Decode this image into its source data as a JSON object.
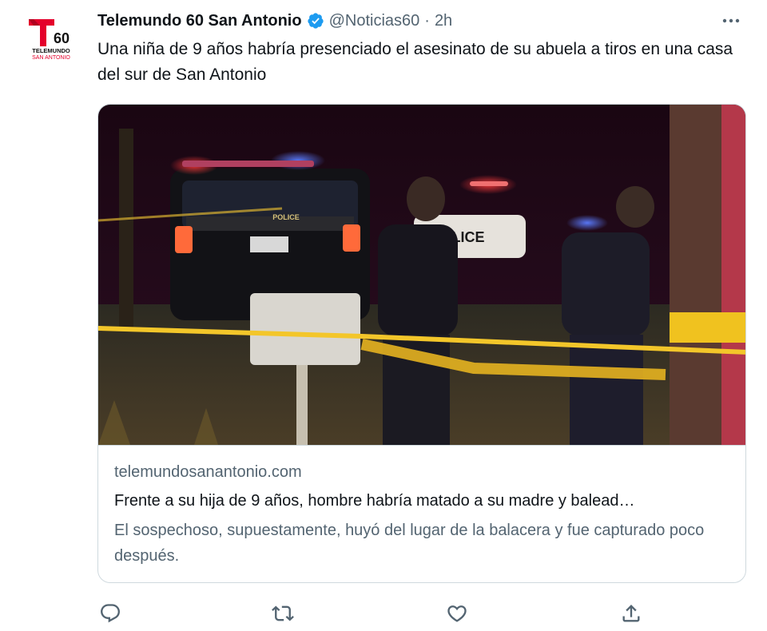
{
  "author": {
    "display_name": "Telemundo 60 San Antonio",
    "handle": "@Noticias60",
    "separator": "·",
    "time": "2h",
    "verified": true,
    "logo": {
      "number": "60",
      "line1": "TELEMUNDO",
      "line2": "SAN ANTONIO",
      "brand_color": "#e4002b"
    }
  },
  "tweet": {
    "text": "Una niña de 9 años habría presenciado el asesinato de su abuela a tiros en una casa del sur de San Antonio"
  },
  "card": {
    "image_alt": "police-scene-photo",
    "image_text": {
      "vehicle_label_left": "POLICE",
      "vehicle_label_right": "POLICE"
    },
    "domain": "telemundosanantonio.com",
    "title": "Frente a su hija de 9 años, hombre habría matado a su madre y balead…",
    "description": "El sospechoso, supuestamente, huyó del lugar de la balacera y fue capturado poco después."
  },
  "actions": [
    {
      "name": "reply-icon"
    },
    {
      "name": "retweet-icon"
    },
    {
      "name": "like-icon"
    },
    {
      "name": "share-icon"
    }
  ],
  "colors": {
    "text": "#0f1419",
    "secondary": "#536471",
    "border": "#cfd9de",
    "verified": "#1d9bf0"
  }
}
